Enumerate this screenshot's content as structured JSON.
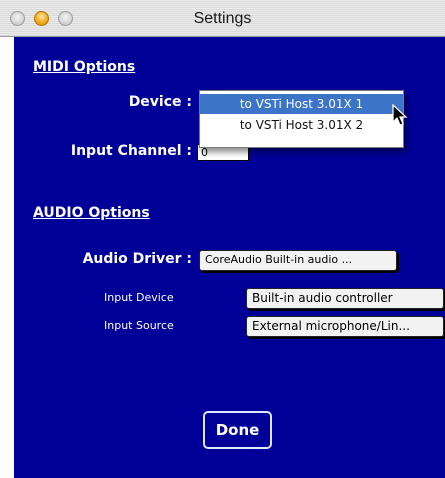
{
  "window": {
    "title": "Settings"
  },
  "midi": {
    "section_title": "MIDI Options",
    "device_label": "Device :",
    "input_channel_label": "Input Channel :",
    "input_channel_value": "0",
    "device_menu": [
      {
        "label": "to VSTi Host 3.01X 1",
        "selected": true
      },
      {
        "label": "to VSTi Host 3.01X 2",
        "selected": false
      }
    ]
  },
  "audio": {
    "section_title": "AUDIO Options",
    "driver_label": "Audio Driver :",
    "driver_value": "CoreAudio Built-in audio ...",
    "input_device_label": "Input Device",
    "input_device_value": "Built-in audio controller",
    "input_source_label": "Input Source",
    "input_source_value": "External microphone/Lin..."
  },
  "done_label": "Done",
  "colors": {
    "panel": "#000099",
    "menu_highlight": "#3c75c8"
  }
}
